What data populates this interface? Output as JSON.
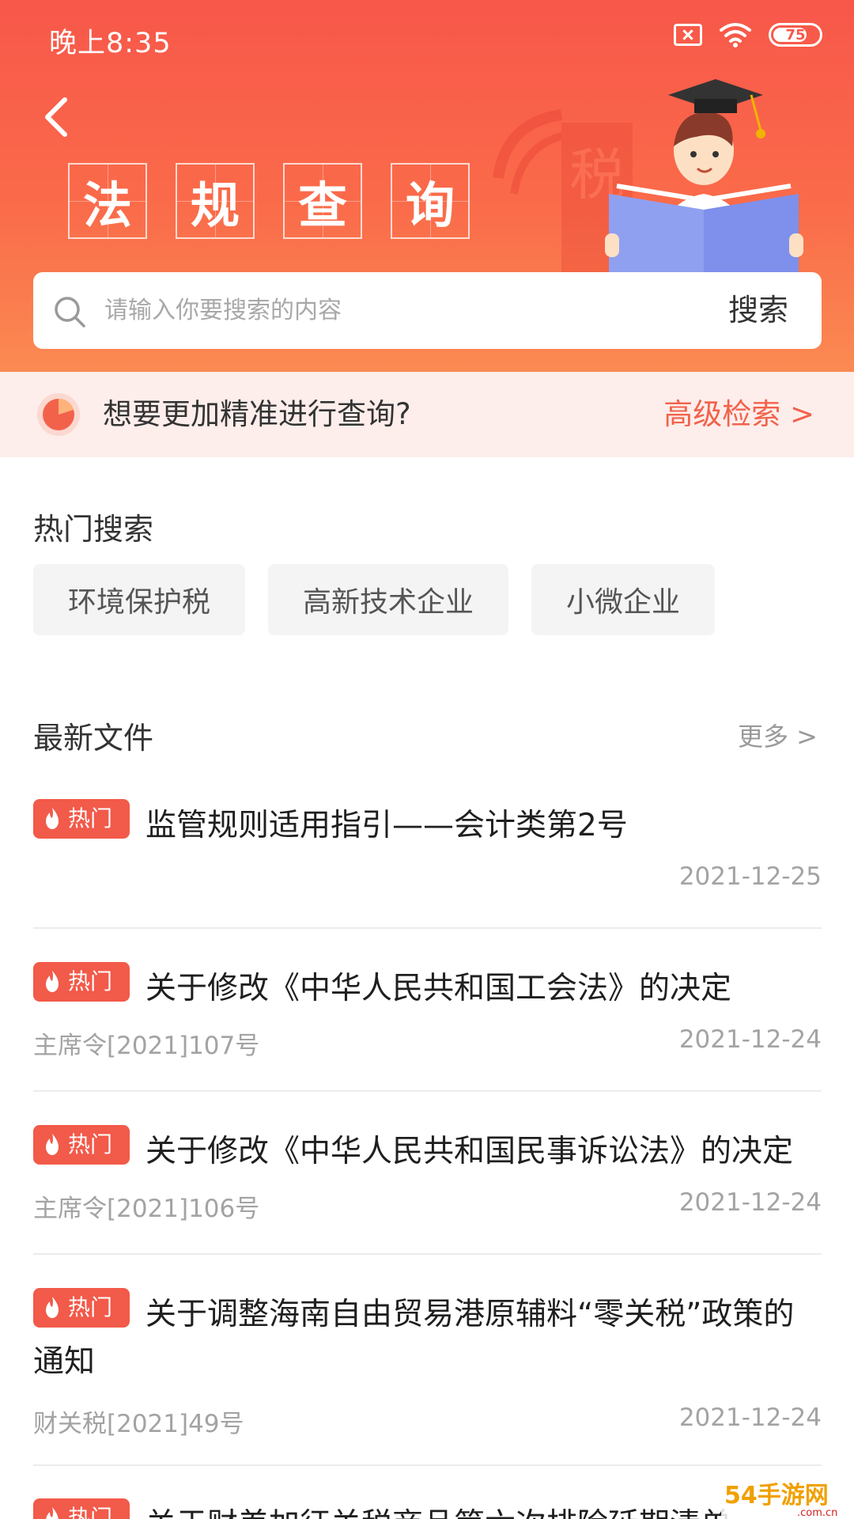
{
  "status_bar": {
    "time": "晚上8:35",
    "battery": "75",
    "battery_level": 0.75
  },
  "header": {
    "title_chars": [
      "法",
      "规",
      "查",
      "询"
    ],
    "badge_char": "税"
  },
  "search": {
    "placeholder": "请输入你要搜索的内容",
    "button_label": "搜索"
  },
  "advanced": {
    "prompt": "想要更加精准进行查询?",
    "link_label": "高级检索 >"
  },
  "hot_search": {
    "title": "热门搜索",
    "tags": [
      "环境保护税",
      "高新技术企业",
      "小微企业"
    ]
  },
  "latest": {
    "title": "最新文件",
    "more_label": "更多 >",
    "badge_label": "热门",
    "items": [
      {
        "title": "监管规则适用指引——会计类第2号",
        "doc_no": "",
        "date": "2021-12-25"
      },
      {
        "title": "关于修改《中华人民共和国工会法》的决定",
        "doc_no": "主席令[2021]107号",
        "date": "2021-12-24"
      },
      {
        "title": "关于修改《中华人民共和国民事诉讼法》的决定",
        "doc_no": "主席令[2021]106号",
        "date": "2021-12-24"
      },
      {
        "title": "关于调整海南自由贸易港原辅料“零关税”政策的通知",
        "doc_no": "财关税[2021]49号",
        "date": "2021-12-24"
      },
      {
        "title": "关于财差加征关税商品第六次排除延期清单",
        "doc_no": "",
        "date": ""
      }
    ]
  },
  "watermark": {
    "text": "54手游网",
    "domain": ".com.cn"
  },
  "colors": {
    "accent": "#f25a4a",
    "header_top": "#f8574a",
    "header_bottom": "#fb8a52",
    "banner_bg": "#fdeeeb"
  }
}
